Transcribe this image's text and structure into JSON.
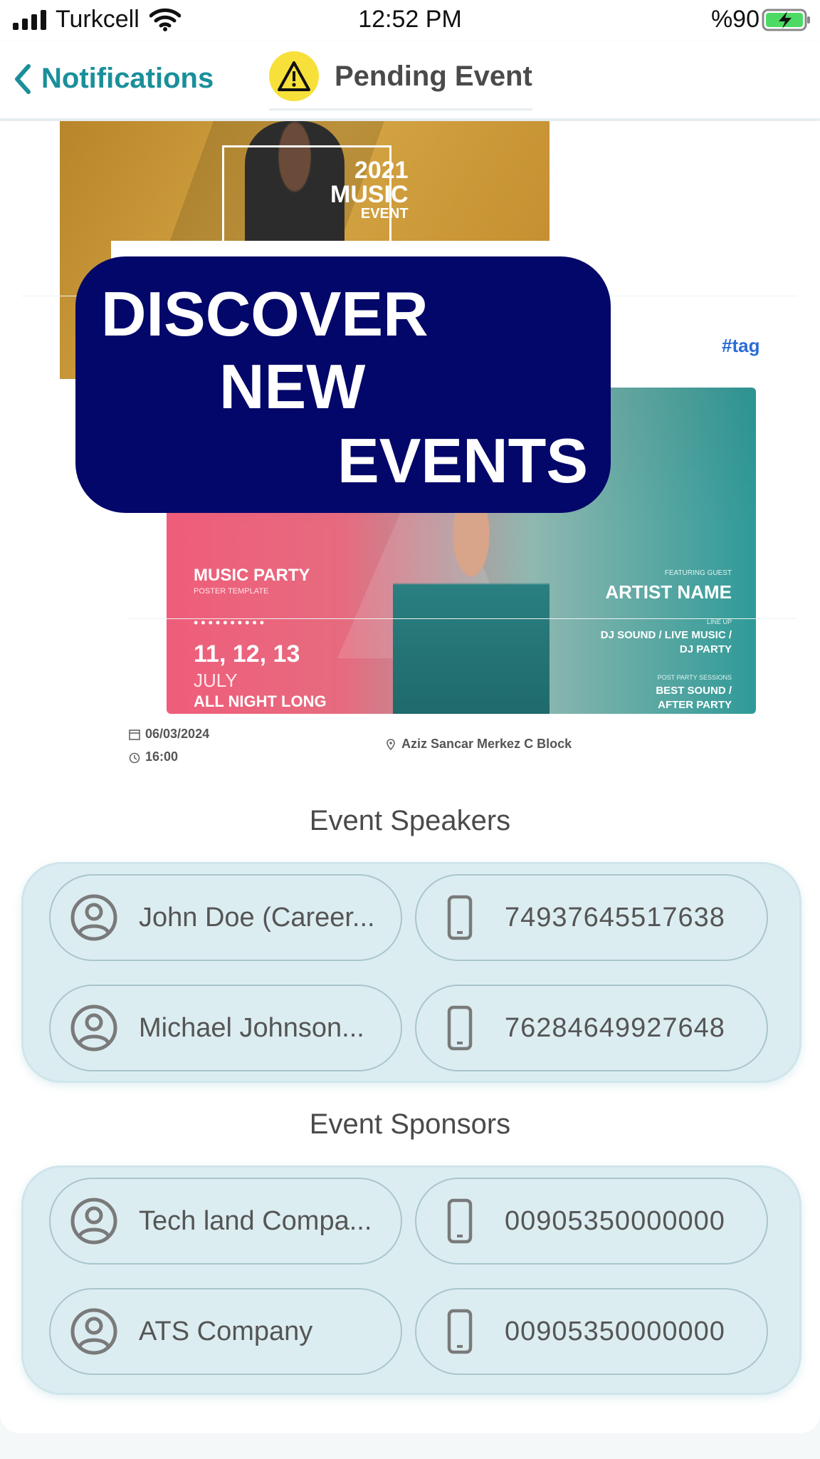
{
  "status_bar": {
    "carrier": "Turkcell",
    "time": "12:52 PM",
    "battery": "%90"
  },
  "nav": {
    "back_label": "Notifications",
    "title": "Pending Event"
  },
  "poster": {
    "year_line1": "2021",
    "year_line2": "MUSIC",
    "year_line3": "EVENT",
    "discover_line1": "DISCOVER",
    "discover_line2": "NEW",
    "discover_line3": "EVENTS",
    "tag": "#tag",
    "party_title": "MUSIC PARTY",
    "party_subtitle": "POSTER TEMPLATE",
    "party_dots": "••••••••••",
    "party_dates": "11, 12, 13",
    "party_month": "JULY",
    "party_night": "ALL NIGHT LONG",
    "featuring": "FEATURING GUEST",
    "artist": "ARTIST NAME",
    "lineup_label": "LINE UP",
    "lineup_line1": "DJ SOUND / LIVE MUSIC /",
    "lineup_line2": "DJ PARTY",
    "after_label": "POST PARTY SESSIONS",
    "after_line1": "BEST SOUND /",
    "after_line2": "AFTER PARTY"
  },
  "event": {
    "date": "06/03/2024",
    "time": "16:00",
    "location": "Aziz Sancar Merkez C Block"
  },
  "speakers": {
    "title": "Event Speakers",
    "items": [
      {
        "name": "John Doe (Career...",
        "phone": "74937645517638"
      },
      {
        "name": "Michael Johnson...",
        "phone": "76284649927648"
      }
    ]
  },
  "sponsors": {
    "title": "Event Sponsors",
    "items": [
      {
        "name": "Tech land Compa...",
        "phone": "00905350000000"
      },
      {
        "name": "ATS Company",
        "phone": "00905350000000"
      }
    ]
  },
  "colors": {
    "accent": "#1a8f9a",
    "banner": "#030769",
    "warning": "#f7e03a",
    "section_bg": "#dcedf1"
  }
}
